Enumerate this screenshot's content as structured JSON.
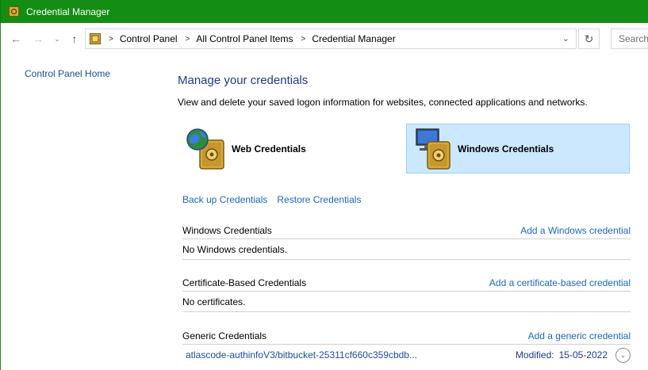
{
  "window": {
    "title": "Credential Manager"
  },
  "nav": {
    "back": "←",
    "forward": "→",
    "recent": "⌄",
    "up": "↑",
    "breadcrumbs": [
      "Control Panel",
      "All Control Panel Items",
      "Credential Manager"
    ],
    "dropdown": "⌄",
    "refresh": "↻",
    "search_placeholder": "Search"
  },
  "sidebar": {
    "home_link": "Control Panel Home"
  },
  "main": {
    "title": "Manage your credentials",
    "description": "View and delete your saved logon information for websites, connected applications and networks.",
    "tiles": {
      "web": "Web Credentials",
      "windows": "Windows Credentials"
    },
    "backup": "Back up Credentials",
    "restore": "Restore Credentials"
  },
  "sections": {
    "windows": {
      "title": "Windows Credentials",
      "add": "Add a Windows credential",
      "empty": "No Windows credentials."
    },
    "certificate": {
      "title": "Certificate-Based Credentials",
      "add": "Add a certificate-based credential",
      "empty": "No certificates."
    },
    "generic": {
      "title": "Generic Credentials",
      "add": "Add a generic credential",
      "items": [
        {
          "name": "atlascode-authinfoV3/bitbucket-25311cf660c359cbdb...",
          "modified_label": "Modified:",
          "modified_date": "15-05-2022"
        }
      ]
    }
  },
  "colors": {
    "titlebar": "#138d13",
    "link": "#1a66c2",
    "heading": "#1e3b8c",
    "selected_tile": "#cce8ff"
  }
}
